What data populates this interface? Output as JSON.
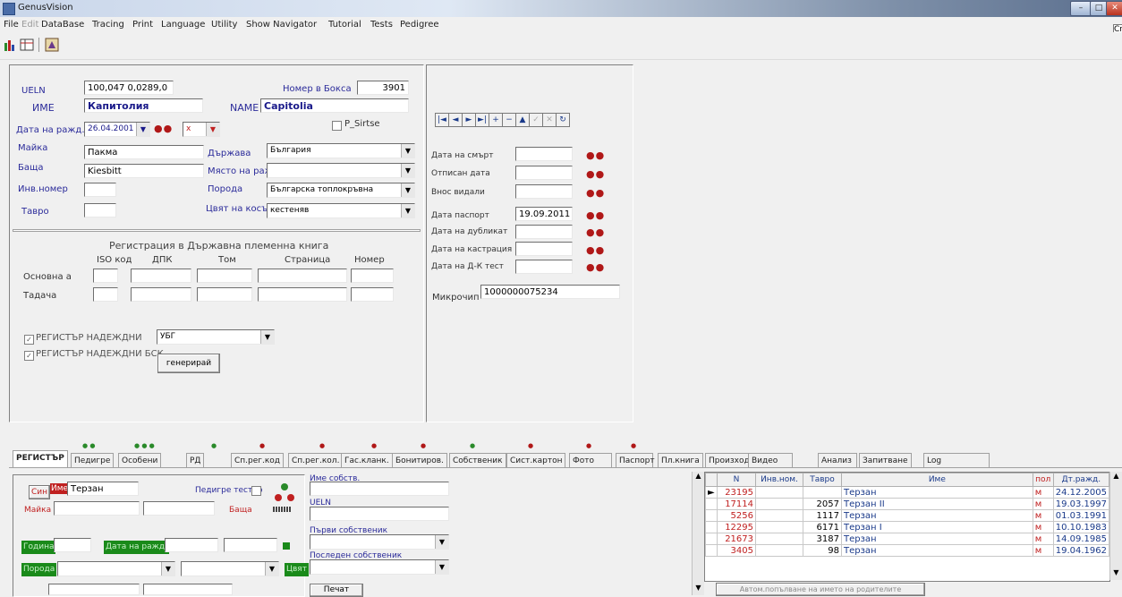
{
  "window": {
    "title": "GenusVision",
    "right_combo_text": "Cr"
  },
  "menu": [
    "File",
    "Edit",
    "DataBase",
    "Tracing",
    "Print",
    "Language",
    "Utility",
    "Show Navigator",
    "Tutorial",
    "Tests",
    "Pedigree"
  ],
  "menu_disabled": [
    "Edit"
  ],
  "form": {
    "ueln_label": "UELN",
    "ueln_value": "100,047 0,0289,0",
    "box_no_label": "Номер в Бокса",
    "box_no_value": "3901",
    "name_label": "ИМЕ",
    "name_value": "Капитолия",
    "name_en_label": "NAME",
    "name_en_value": "Capitolia",
    "psirtse_label": "P_Sirtse",
    "birth_label": "Дата на ражд.",
    "birth_value": "26.04.2001",
    "sex_value": "х",
    "mother_label": "Майка",
    "mother_value": "Пакма",
    "father_label": "Баща",
    "father_value": "Kiesbitt",
    "invno_label": "Инв.номер",
    "invno_value": "",
    "tavro_label": "Тавро",
    "tavro_value": "",
    "country_label": "Държава",
    "country_value": "България",
    "birthplace_label": "Място на ражд.",
    "birthplace_value": "",
    "breed_label": "Порода",
    "breed_value": "Българска топлокръвна",
    "color_label": "Цвят на косъма",
    "color_value": "кестеняв",
    "registry_title": "Регистрация в Държавна племенна книга",
    "reg_cols": [
      "ISO код",
      "ДПК",
      "Том",
      "Страница",
      "Номер"
    ],
    "reg_rows": [
      "Основна а",
      "Тадача"
    ],
    "reg_values": [
      [
        "",
        "",
        "",
        "",
        ""
      ],
      [
        "",
        "",
        "",
        "",
        ""
      ]
    ],
    "check1_label": "РЕГИСТЪР НАДЕЖДНИ",
    "check1_combo": "УБГ",
    "check2_label": "РЕГИСТЪР НАДЕЖДНИ БСК",
    "generate_btn": "генерирай"
  },
  "right_form": {
    "death_label": "Дата на смърт",
    "death_value": "",
    "off_label": "Отписан дата",
    "off_value": "",
    "import_label": "Внос видали",
    "import_value": "",
    "passport_label": "Дата паспорт",
    "passport_value": "19.09.2011",
    "dup_label": "Дата на дубликат",
    "dup_value": "",
    "castr_label": "Дата на кастрация",
    "castr_value": "",
    "dna_label": "Дата на Д-К тест",
    "dna_value": "",
    "micro_label": "Микрочип",
    "micro_value": "1000000075234",
    "nav_buttons": [
      "|◄",
      "◄",
      "►",
      "►|",
      "+",
      "−",
      "▲",
      "✓",
      "✕",
      "↻"
    ]
  },
  "tabs": [
    "РЕГИСТЪР",
    "Педигре",
    "Особени",
    "РД",
    "Сп.рег.код",
    "Сп.рег.кол.",
    "Гас.кланк.",
    "Бонитиров.",
    "Собственик",
    "Сист.картон",
    "Фото",
    "Паспорт",
    "Пл.книга",
    "Произход",
    "Видео",
    "Анализ",
    "Запитване",
    "Log"
  ],
  "bottom": {
    "sire_btn": "Син",
    "name_lbl": "Име",
    "name_value": "Терзан",
    "mother_lbl": "Майка",
    "father_lbl": "Баща",
    "pedigree_lbl": "Педигре тестер",
    "owner_lbl": "Име собств.",
    "ueln_lbl": "UELN",
    "first_owner_lbl": "Първи собственик",
    "last_owner_lbl": "Последен собственик",
    "green1": "Година",
    "green2": "Дата на ражд.",
    "green3": "Порода",
    "green4": "Цвят",
    "bottom_btn": "Печат"
  },
  "grid": {
    "columns": [
      "N",
      "Инв.ном.",
      "Тавро",
      "Име",
      "пол",
      "Дт.ражд."
    ],
    "rows": [
      [
        "23195",
        "",
        "",
        "Терзан",
        "м",
        "24.12.2005"
      ],
      [
        "17114",
        "",
        "2057",
        "Терзан II",
        "м",
        "19.03.1997"
      ],
      [
        "5256",
        "",
        "1117",
        "Терзан",
        "м",
        "01.03.1991"
      ],
      [
        "12295",
        "",
        "6171",
        "Терзан I",
        "м",
        "10.10.1983"
      ],
      [
        "21673",
        "",
        "3187",
        "Терзан",
        "м",
        "14.09.1985"
      ],
      [
        "3405",
        "",
        "98",
        "Терзан",
        "м",
        "19.04.1962"
      ]
    ],
    "footer_btn": "Автом.попълване на името на родителите"
  }
}
